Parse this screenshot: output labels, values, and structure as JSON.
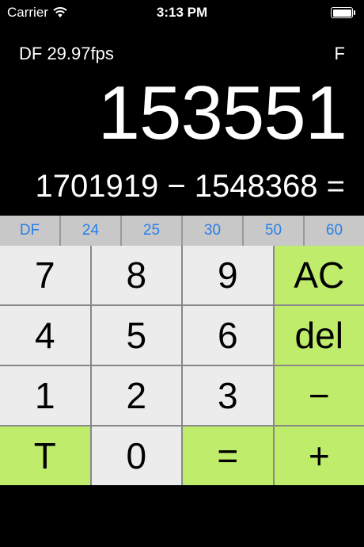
{
  "status_bar": {
    "carrier": "Carrier",
    "time": "3:13 PM"
  },
  "display": {
    "mode": "DF 29.97fps",
    "format": "F",
    "result": "153551",
    "expression": "1701919 − 1548368 ="
  },
  "fps_buttons": [
    "DF",
    "24",
    "25",
    "30",
    "50",
    "60"
  ],
  "keys": [
    [
      "7",
      "8",
      "9",
      "AC"
    ],
    [
      "4",
      "5",
      "6",
      "del"
    ],
    [
      "1",
      "2",
      "3",
      "−"
    ],
    [
      "T",
      "0",
      "=",
      "+"
    ]
  ],
  "colors": {
    "accent": "#c0ec6b",
    "key": "#ececec",
    "fps_text": "#2a7fe8"
  }
}
